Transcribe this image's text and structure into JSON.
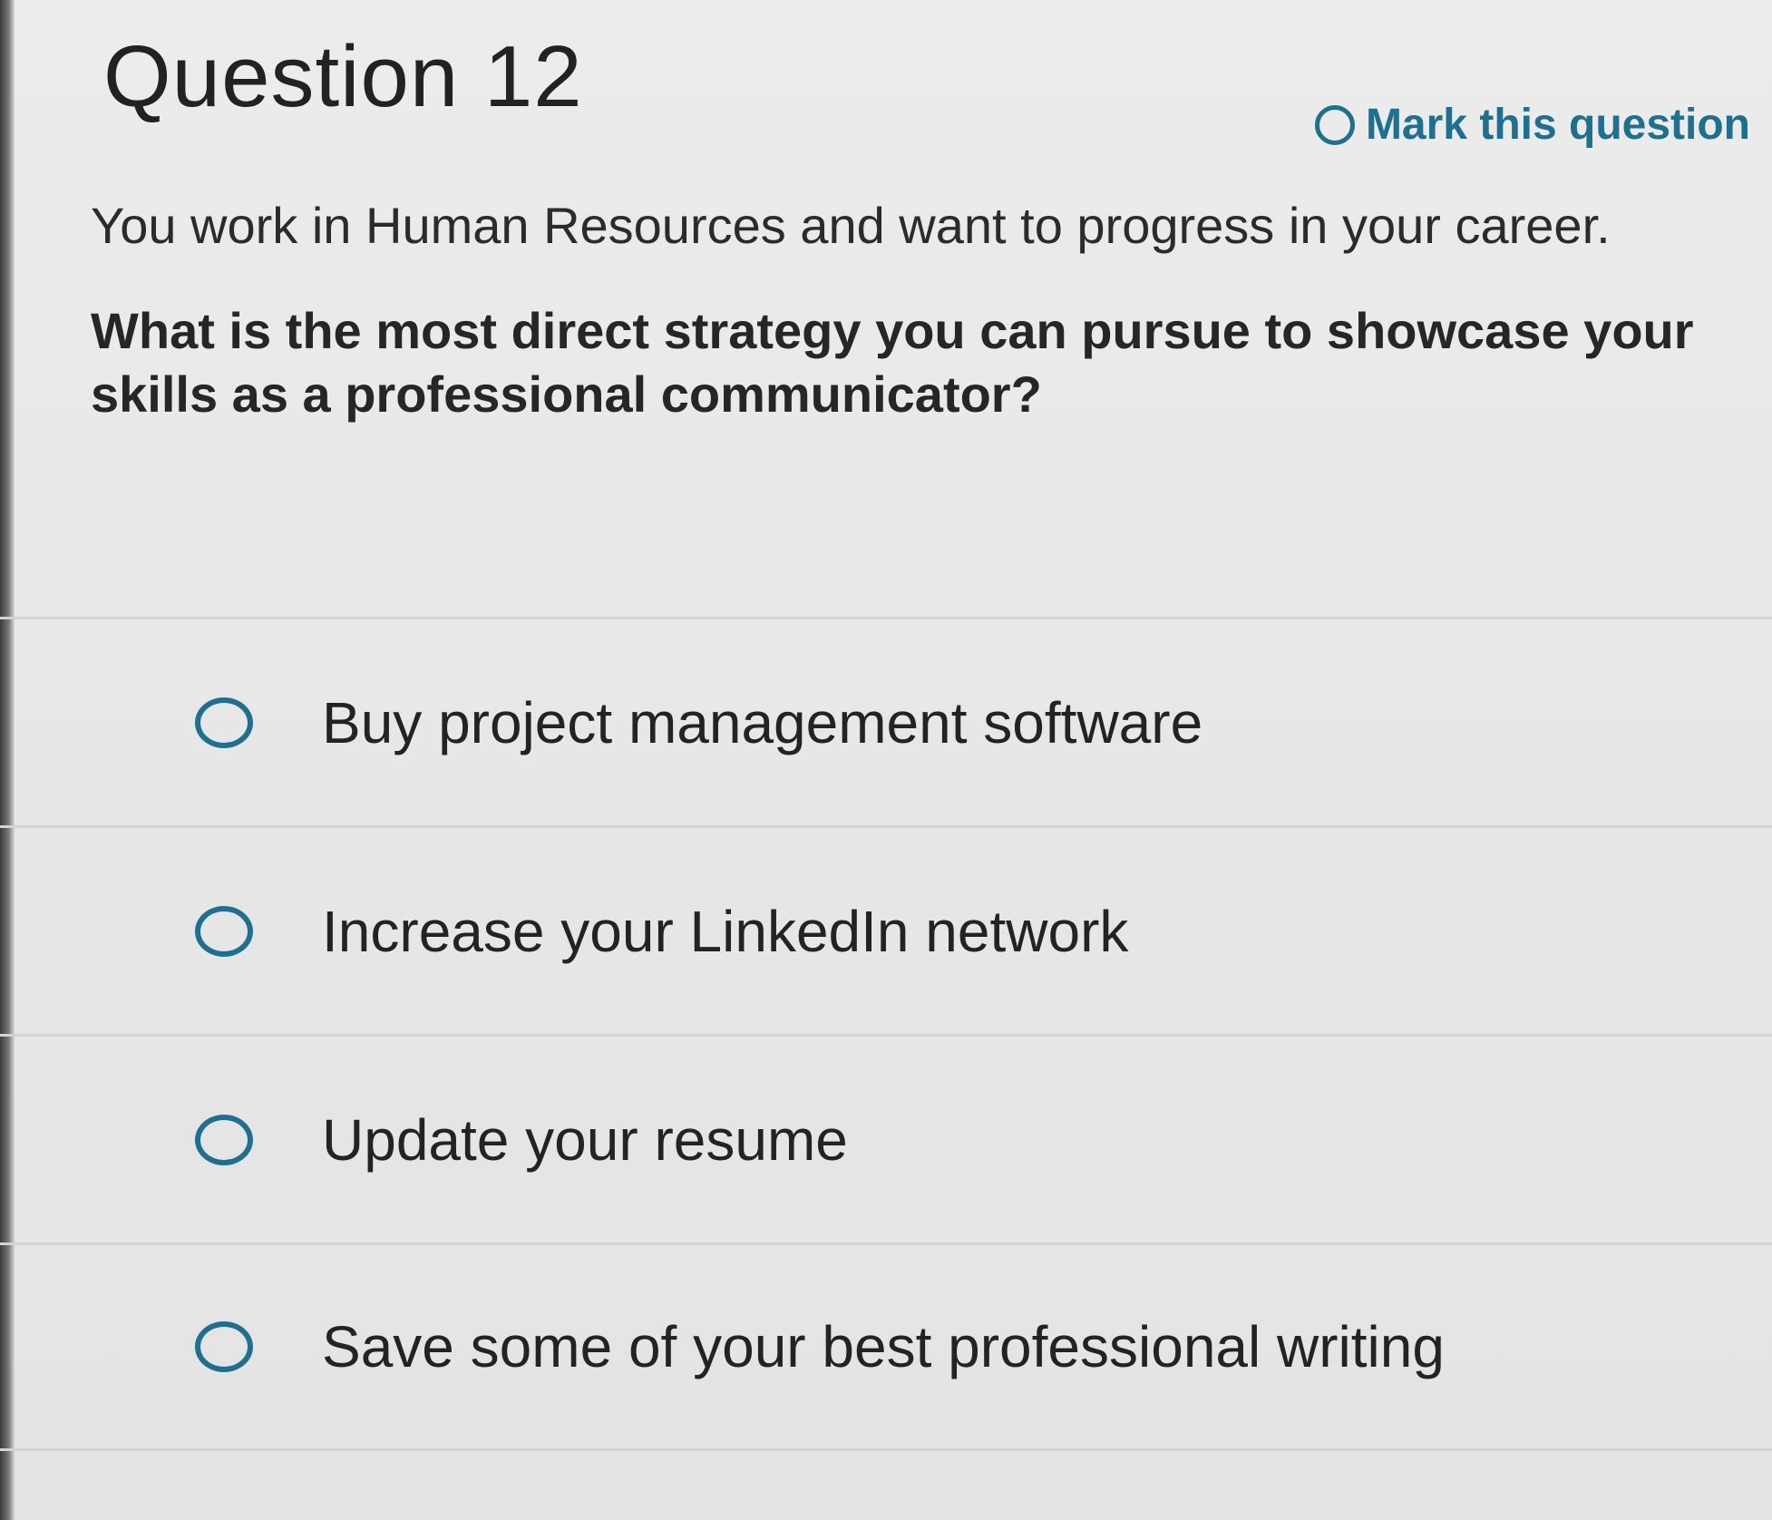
{
  "header": {
    "title": "Question 12",
    "mark_label": "Mark this question"
  },
  "question": {
    "context": "You work in Human Resources and want to progress in your career.",
    "prompt": "What is the most direct strategy you can pursue to showcase your skills as a professional communicator?"
  },
  "answers": [
    {
      "label": "Buy project management software",
      "selected": false
    },
    {
      "label": "Increase your LinkedIn network",
      "selected": false
    },
    {
      "label": "Update your resume",
      "selected": false
    },
    {
      "label": "Save some of your best professional writing",
      "selected": false
    }
  ],
  "colors": {
    "accent": "#1f6f8e",
    "background": "#eaeaea",
    "text": "#2a2a2a",
    "divider": "#d4d4d4"
  },
  "icons": {
    "mark": "radio-circle-icon",
    "answer": "radio-circle-icon"
  }
}
